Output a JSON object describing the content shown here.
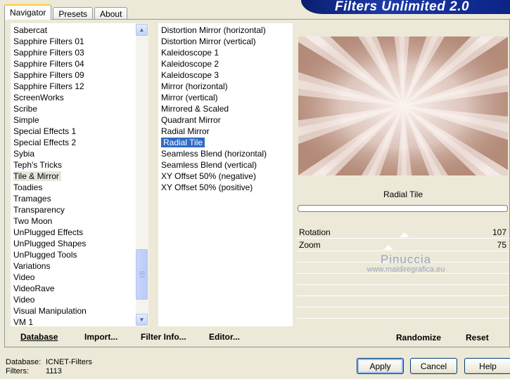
{
  "tabs": [
    "Navigator",
    "Presets",
    "About"
  ],
  "banner_title": "Filters Unlimited 2.0",
  "categories": [
    "Sabercat",
    "Sapphire Filters 01",
    "Sapphire Filters 03",
    "Sapphire Filters 04",
    "Sapphire Filters 09",
    "Sapphire Filters 12",
    "ScreenWorks",
    "Scribe",
    "Simple",
    "Special Effects 1",
    "Special Effects 2",
    "Sybia",
    "Teph's Tricks",
    "Tile & Mirror",
    "Toadies",
    "Tramages",
    "Transparency",
    "Two Moon",
    "UnPlugged Effects",
    "UnPlugged Shapes",
    "UnPlugged Tools",
    "Variations",
    "Video",
    "VideoRave",
    "Video",
    "Visual Manipulation",
    "VM 1"
  ],
  "selected_category": "Tile & Mirror",
  "filters": [
    "Distortion Mirror (horizontal)",
    "Distortion Mirror (vertical)",
    "Kaleidoscope 1",
    "Kaleidoscope 2",
    "Kaleidoscope 3",
    "Mirror (horizontal)",
    "Mirror (vertical)",
    "Mirrored & Scaled",
    "Quadrant Mirror",
    "Radial Mirror",
    "Radial Tile",
    "Seamless Blend (horizontal)",
    "Seamless Blend (vertical)",
    "XY Offset 50% (negative)",
    "XY Offset 50% (positive)"
  ],
  "selected_filter": "Radial Tile",
  "preview": {
    "filter_name": "Radial Tile",
    "colors": {
      "light": "#f7ece8",
      "dark": "#b48a78"
    }
  },
  "params": [
    {
      "label": "Rotation",
      "value": "107",
      "level": 0.42
    },
    {
      "label": "Zoom",
      "value": "75",
      "level": 0.29
    }
  ],
  "watermark": {
    "line1": "Pinuccia",
    "line2": "www.maidiregrafica.eu"
  },
  "bottom_buttons": {
    "database": "Database",
    "import": "Import...",
    "filter_info": "Filter Info...",
    "editor": "Editor..."
  },
  "right_buttons": {
    "randomize": "Randomize",
    "reset": "Reset"
  },
  "info": {
    "database_label": "Database:",
    "database_value": "ICNET-Filters",
    "filters_label": "Filters:",
    "filters_value": "1113"
  },
  "dialog_buttons": {
    "apply": "Apply",
    "cancel": "Cancel",
    "help": "Help"
  },
  "colors": {
    "selection": "#316ac5",
    "panel": "#ece9d8",
    "banner": "#0b2385"
  }
}
